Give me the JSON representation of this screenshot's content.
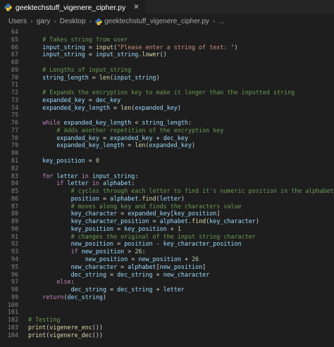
{
  "tab": {
    "label": "geektechstuff_vigenere_cipher.py",
    "close_glyph": "✕",
    "icon": "python-file-icon"
  },
  "breadcrumb": {
    "items": [
      "Users",
      "gary",
      "Desktop",
      "geektechstuff_vigenere_cipher.py",
      "..."
    ],
    "separator": "›"
  },
  "colors": {
    "background": "#1e1e1e",
    "tabbar": "#252526",
    "comment": "#6a9955",
    "string": "#ce9178",
    "keyword": "#c586c0",
    "function": "#dcdcaa",
    "number": "#b5cea8",
    "line_number": "#858585"
  },
  "code_lines": [
    {
      "n": "64",
      "t": ""
    },
    {
      "n": "65",
      "t": "    # Takes string from user"
    },
    {
      "n": "66",
      "t": "    input_string = input(\"Please enter a string of text: \")"
    },
    {
      "n": "67",
      "t": "    input_string = input_string.lower()"
    },
    {
      "n": "68",
      "t": ""
    },
    {
      "n": "69",
      "t": "    # Lengths of input_string"
    },
    {
      "n": "70",
      "t": "    string_length = len(input_string)"
    },
    {
      "n": "71",
      "t": ""
    },
    {
      "n": "72",
      "t": "    # Expands the encryption key to make it longer than the inputted string"
    },
    {
      "n": "73",
      "t": "    expanded_key = dec_key"
    },
    {
      "n": "74",
      "t": "    expanded_key_length = len(expanded_key)"
    },
    {
      "n": "75",
      "t": ""
    },
    {
      "n": "76",
      "t": "    while expanded_key_length < string_length:"
    },
    {
      "n": "77",
      "t": "        # Adds another repetition of the encryption key"
    },
    {
      "n": "78",
      "t": "        expanded_key = expanded_key + dec_key"
    },
    {
      "n": "79",
      "t": "        expanded_key_length = len(expanded_key)"
    },
    {
      "n": "80",
      "t": ""
    },
    {
      "n": "81",
      "t": "    key_position = 0"
    },
    {
      "n": "82",
      "t": ""
    },
    {
      "n": "83",
      "t": "    for letter in input_string:"
    },
    {
      "n": "84",
      "t": "        if letter in alphabet:"
    },
    {
      "n": "85",
      "t": "            # cycles through each letter to find it's numeric position in the alphabet"
    },
    {
      "n": "86",
      "t": "            position = alphabet.find(letter)"
    },
    {
      "n": "87",
      "t": "            # moves along key and finds the characters value"
    },
    {
      "n": "88",
      "t": "            key_character = expanded_key[key_position]"
    },
    {
      "n": "89",
      "t": "            key_character_position = alphabet.find(key_character)"
    },
    {
      "n": "90",
      "t": "            key_position = key_position + 1"
    },
    {
      "n": "91",
      "t": "            # changes the original of the input string character"
    },
    {
      "n": "92",
      "t": "            new_position = position - key_character_position"
    },
    {
      "n": "93",
      "t": "            if new_position > 26:"
    },
    {
      "n": "94",
      "t": "                new_position = new_position + 26"
    },
    {
      "n": "95",
      "t": "            new_character = alphabet[new_position]"
    },
    {
      "n": "96",
      "t": "            dec_string = dec_string + new_character"
    },
    {
      "n": "97",
      "t": "        else:"
    },
    {
      "n": "98",
      "t": "            dec_string = dec_string + letter"
    },
    {
      "n": "99",
      "t": "    return(dec_string)"
    },
    {
      "n": "100",
      "t": ""
    },
    {
      "n": "101",
      "t": ""
    },
    {
      "n": "102",
      "t": "# Testing"
    },
    {
      "n": "103",
      "t": "print(vigenere_enc())"
    },
    {
      "n": "104",
      "t": "print(vigenere_dec())"
    }
  ]
}
